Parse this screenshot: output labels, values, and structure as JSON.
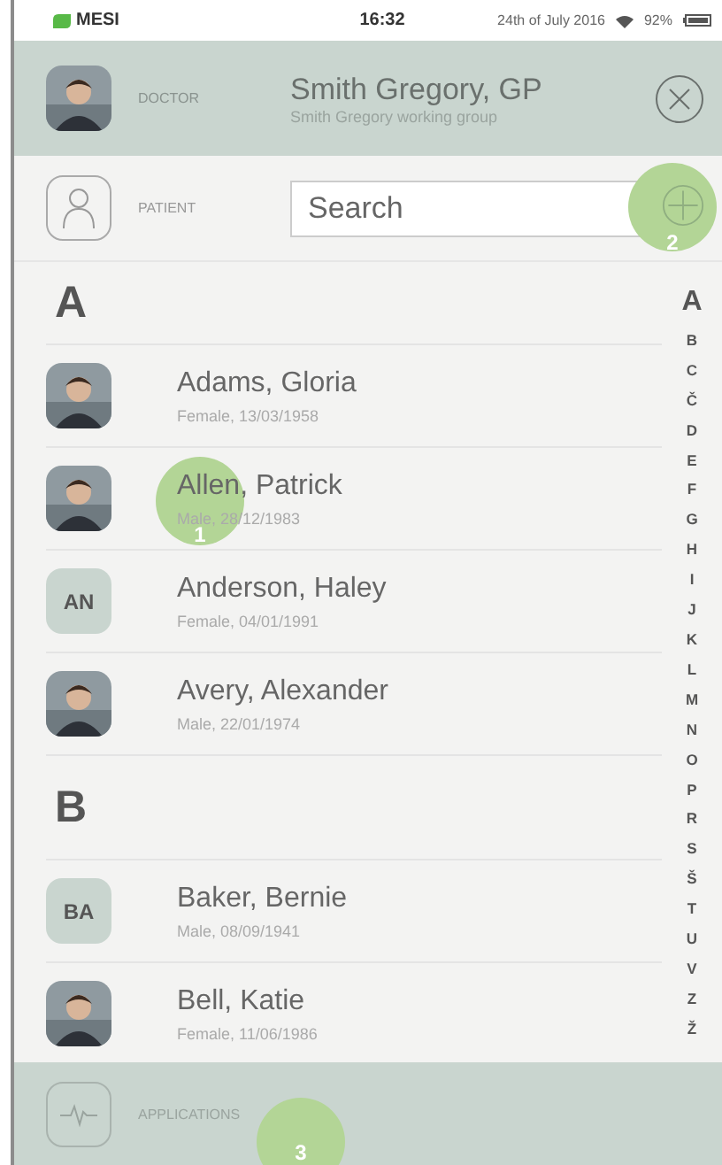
{
  "status_bar": {
    "carrier": "MESI",
    "time": "16:32",
    "date": "24th of July 2016",
    "battery": "92%"
  },
  "doctor": {
    "label": "DOCTOR",
    "name": "Smith Gregory, GP",
    "group": "Smith Gregory working group"
  },
  "patient": {
    "label": "PATIENT",
    "search": {
      "placeholder": "Search"
    }
  },
  "sections": [
    {
      "letter": "A",
      "patients": [
        {
          "name": "Adams, Gloria",
          "details": "Female, 13/03/1958"
        },
        {
          "name": "Allen, Patrick",
          "details": "Male, 28/12/1983"
        },
        {
          "name": "Anderson, Haley",
          "details": "Female, 04/01/1991",
          "avatar": {
            "kind": "initials",
            "text": "AN"
          }
        },
        {
          "name": "Avery, Alexander",
          "details": "Male, 22/01/1974"
        }
      ]
    },
    {
      "letter": "B",
      "patients": [
        {
          "name": "Baker, Bernie",
          "details": "Male, 08/09/1941",
          "avatar": {
            "kind": "initials",
            "text": "BA"
          }
        },
        {
          "name": "Bell, Katie",
          "details": "Female, 11/06/1986"
        }
      ]
    }
  ],
  "alphabet_index": [
    {
      "letter": "A",
      "selected": true
    },
    {
      "letter": "B",
      "selected": false
    },
    {
      "letter": "C",
      "selected": false
    },
    {
      "letter": "Č",
      "selected": false
    },
    {
      "letter": "D",
      "selected": false
    },
    {
      "letter": "E",
      "selected": false
    },
    {
      "letter": "F",
      "selected": false
    },
    {
      "letter": "G",
      "selected": false
    },
    {
      "letter": "H",
      "selected": false
    },
    {
      "letter": "I",
      "selected": false
    },
    {
      "letter": "J",
      "selected": false
    },
    {
      "letter": "K",
      "selected": false
    },
    {
      "letter": "L",
      "selected": false
    },
    {
      "letter": "M",
      "selected": false
    },
    {
      "letter": "N",
      "selected": false
    },
    {
      "letter": "O",
      "selected": false
    },
    {
      "letter": "P",
      "selected": false
    },
    {
      "letter": "R",
      "selected": false
    },
    {
      "letter": "S",
      "selected": false
    },
    {
      "letter": "Š",
      "selected": false
    },
    {
      "letter": "T",
      "selected": false
    },
    {
      "letter": "U",
      "selected": false
    },
    {
      "letter": "V",
      "selected": false
    },
    {
      "letter": "Z",
      "selected": false
    },
    {
      "letter": "Ž",
      "selected": false
    }
  ],
  "applications": {
    "label": "APPLICATIONS"
  },
  "touch_markers": [
    {
      "label": "1"
    },
    {
      "label": "2"
    },
    {
      "label": "3"
    }
  ]
}
